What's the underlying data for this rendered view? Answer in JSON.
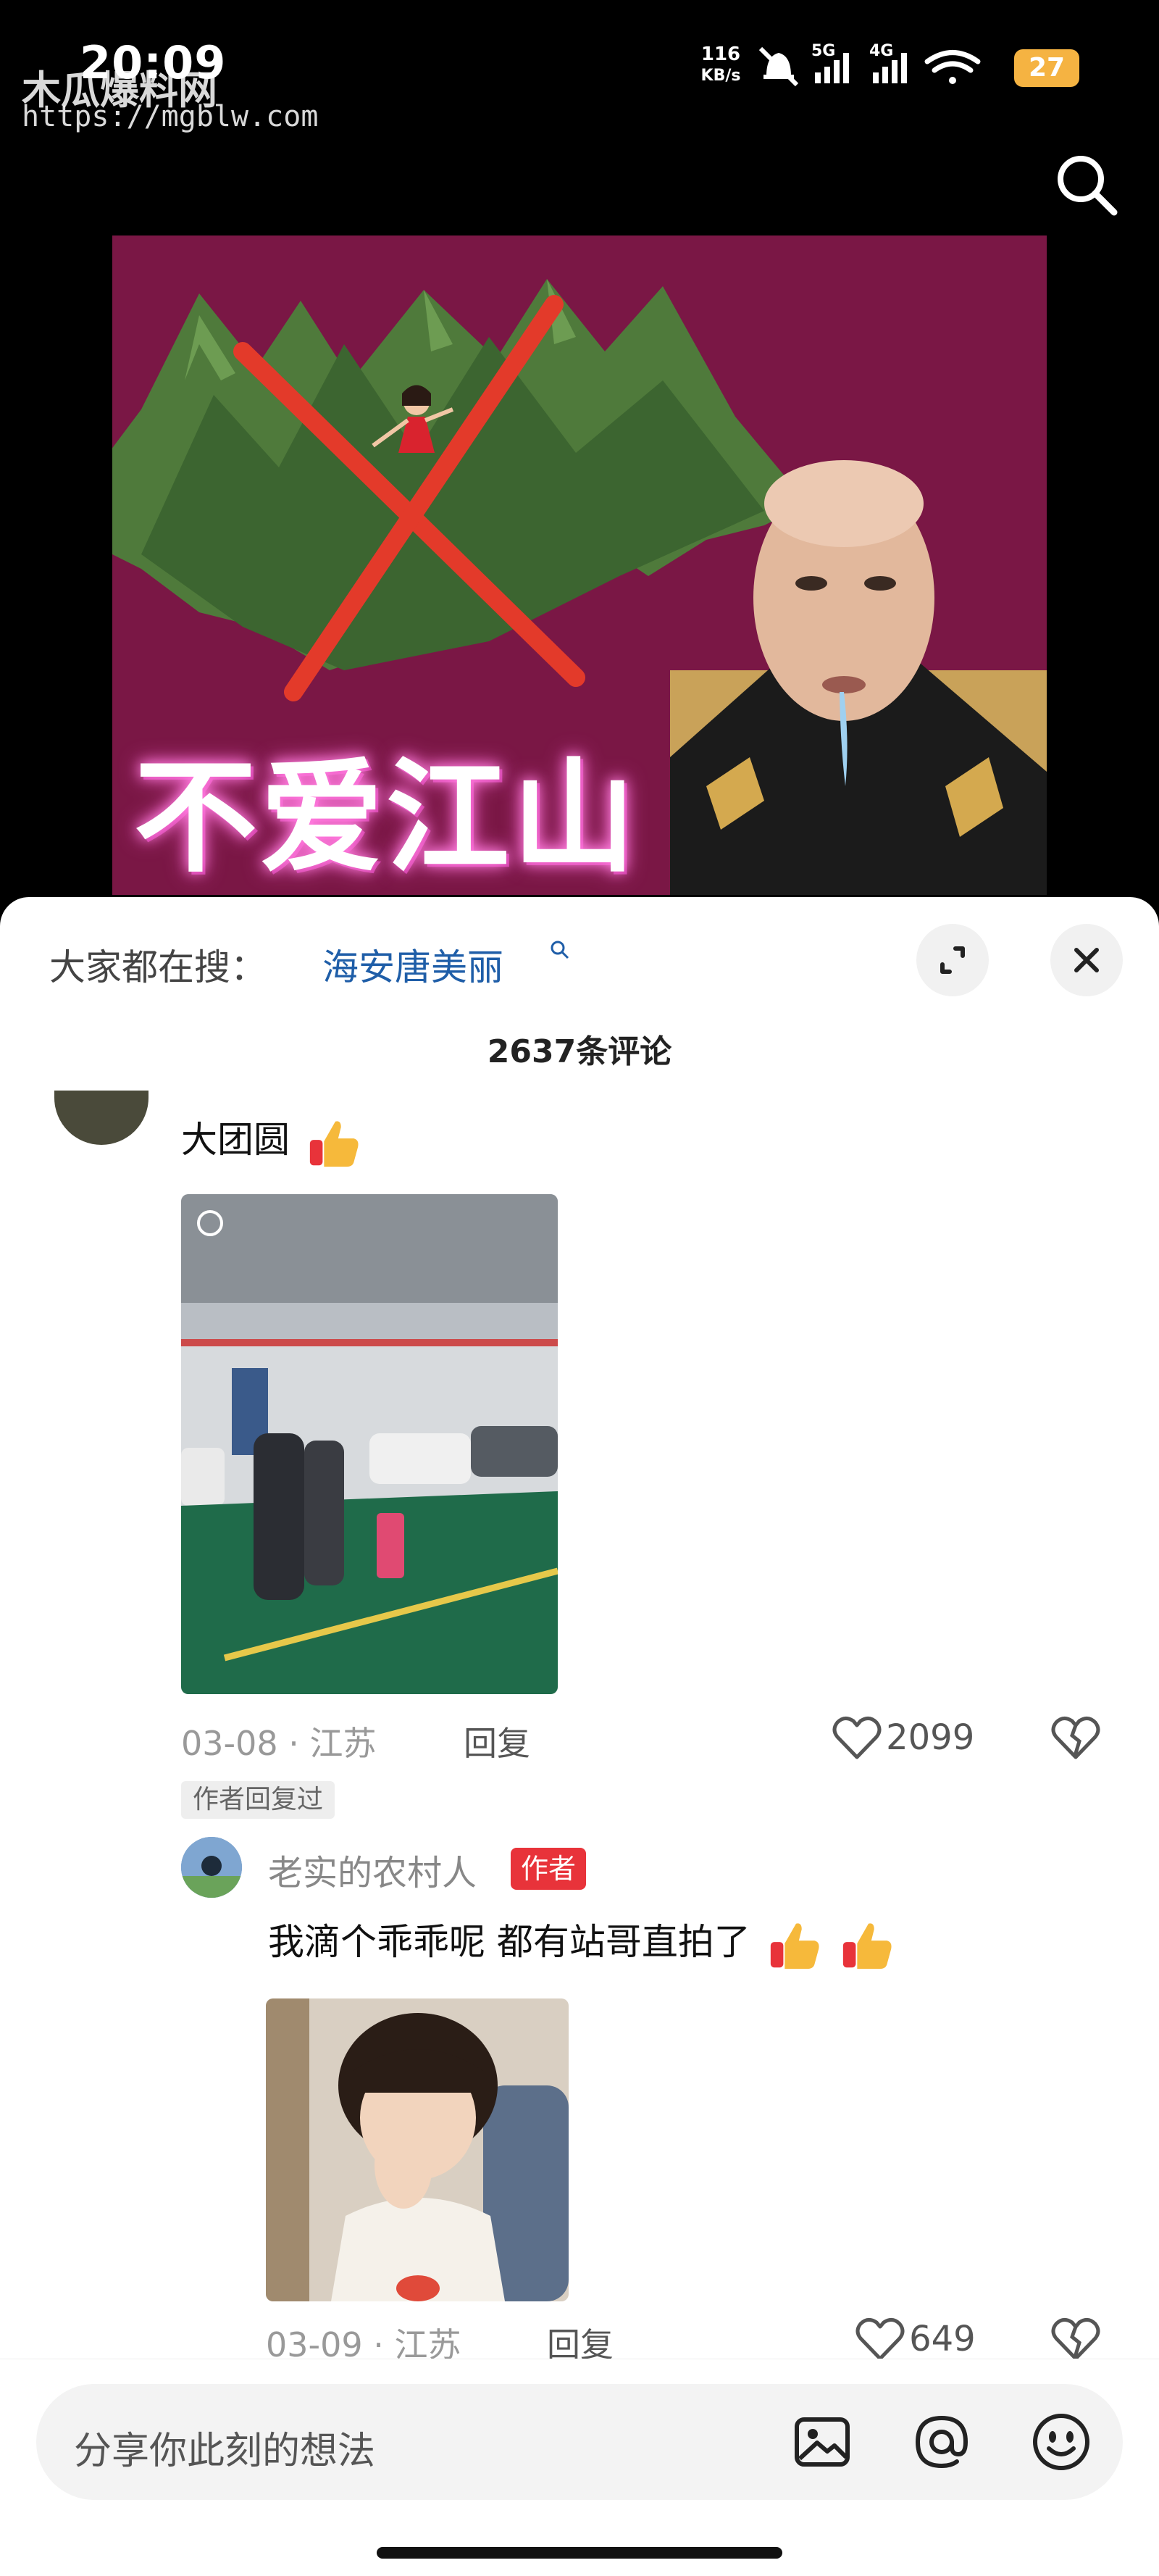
{
  "status_bar": {
    "time": "20:09",
    "net_speed_value": "116",
    "net_speed_unit": "KB/s",
    "signal_5g": "5G",
    "signal_4g": "4G",
    "battery": "27"
  },
  "watermark": {
    "site_name": "木瓜爆料网",
    "url": "https://mgblw.com"
  },
  "video": {
    "overlay_text": "不爱江山"
  },
  "comments_sheet": {
    "trending_prefix": "大家都在搜：",
    "trending_term": "海安唐美丽",
    "comment_count": "2637条评论",
    "comment": {
      "text": "大团圆",
      "date": "03-08",
      "location": "江苏",
      "reply_label": "回复",
      "likes": "2099",
      "author_replied_badge": "作者回复过"
    },
    "reply": {
      "username": "老实的农村人",
      "author_tag": "作者",
      "text": "我滴个乖乖呢 都有站哥直拍了",
      "date": "03-09",
      "location": "江苏",
      "reply_label": "回复",
      "likes": "649"
    }
  },
  "input_bar": {
    "placeholder": "分享你此刻的想法"
  },
  "icons": {
    "search": "search-icon",
    "expand": "expand-icon",
    "close": "close-icon",
    "like": "heart-icon",
    "dislike": "broken-heart-icon",
    "image": "image-icon",
    "mention": "at-icon",
    "emoji": "emoji-icon"
  },
  "colors": {
    "accent_link": "#1f5ea8",
    "author_tag_bg": "#e8333a",
    "video_bg": "#7a1745",
    "battery": "#f5b342"
  }
}
